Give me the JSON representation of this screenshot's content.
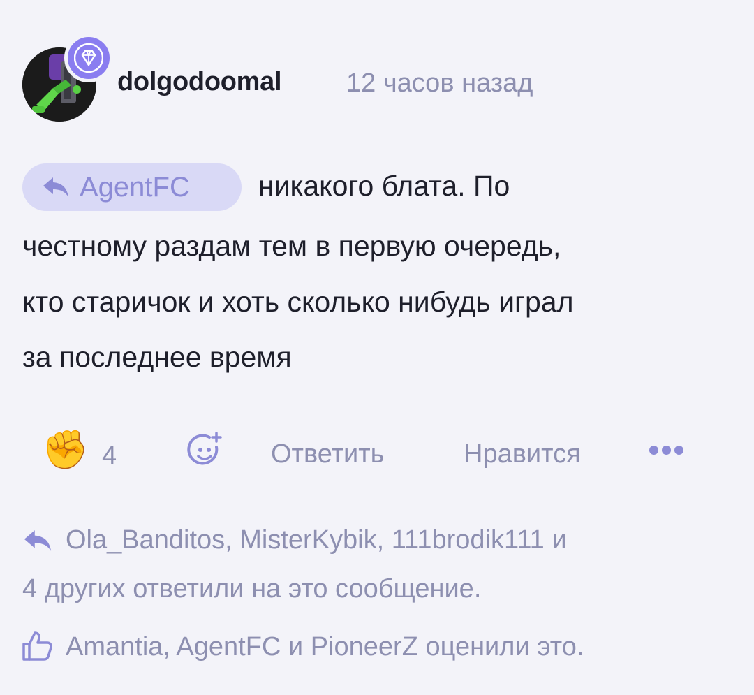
{
  "comment": {
    "username": "dolgodoomal",
    "timestamp": "12 часов назад",
    "reply_to": "AgentFC",
    "text_lines": [
      "никакого блата. По",
      "честному раздам тем в первую очередь,",
      "кто старичок и хоть сколько нибудь играл",
      "за последнее время"
    ]
  },
  "actions": {
    "reaction_icon": "raised-fist-emoji",
    "reaction_glyph": "✊",
    "reaction_count": "4",
    "add_reaction_icon": "smiley-plus-icon",
    "reply_label": "Ответить",
    "like_label": "Нравится",
    "more_icon": "more-dots-icon"
  },
  "replies_summary": {
    "line1": "Ola_Banditos, MisterKybik, 111brodik111 и",
    "line2": "4 других ответили на это сообщение."
  },
  "likes_summary": {
    "text": "Amantia, AgentFC и PioneerZ оценили это."
  },
  "colors": {
    "background": "#f3f3f9",
    "text": "#1e1f2b",
    "muted": "#8d8fb0",
    "accent": "#8c8bd6",
    "chip_bg": "#d9d9f6",
    "badge": "#8a7df0"
  }
}
